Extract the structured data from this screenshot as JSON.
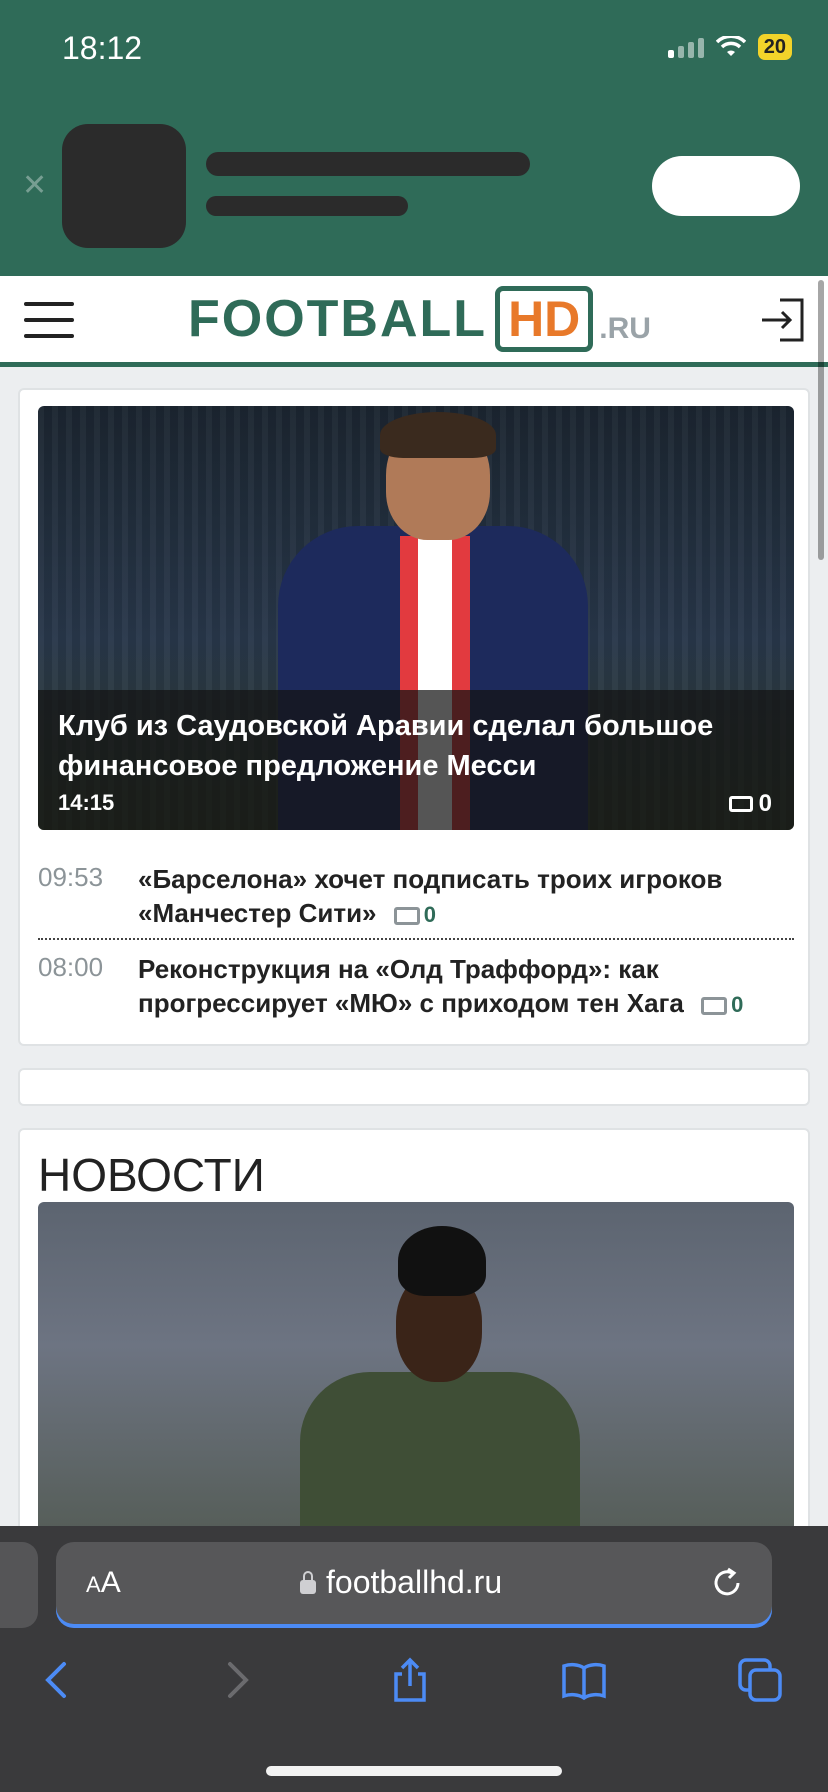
{
  "status_bar": {
    "time": "18:12",
    "battery": "20"
  },
  "site": {
    "logo_football": "FOOTBALL",
    "logo_hd": "HD",
    "logo_ru": ".RU"
  },
  "top_news": {
    "hero": {
      "title": "Клуб из Саудовской Аравии сделал большое финансовое предложение Месси",
      "time": "14:15",
      "comments": "0"
    },
    "items": [
      {
        "time": "09:53",
        "title": "«Барселона» хочет подписать троих игроков «Манчестер Сити»",
        "comments": "0"
      },
      {
        "time": "08:00",
        "title": "Реконструкция на «Олд Траффорд»: как прогрессирует «МЮ» с приходом тен Хага",
        "comments": "0"
      }
    ]
  },
  "news_section": {
    "title": "НОВОСТИ"
  },
  "browser": {
    "aa_label": "AA",
    "url": "footballhd.ru",
    "accent": "#4c8bf5"
  },
  "colors": {
    "brand_green": "#2f6b58",
    "brand_orange": "#e8792a"
  }
}
